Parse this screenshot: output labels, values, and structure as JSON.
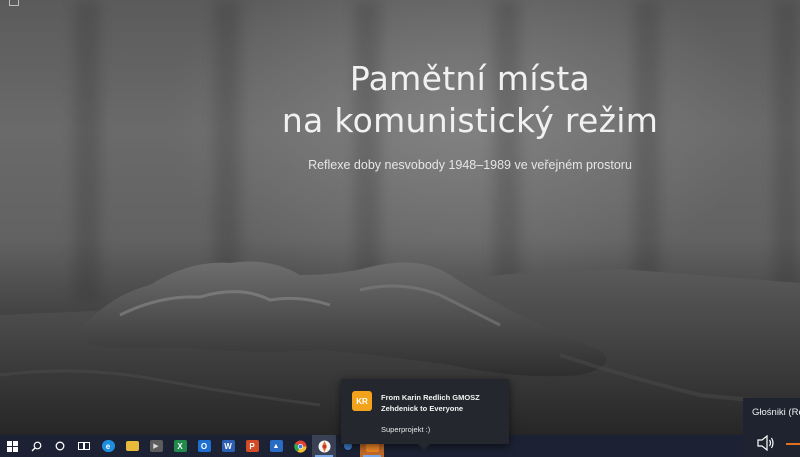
{
  "hero": {
    "title_line1": "Pamětní místa",
    "title_line2": "na komunistický režim",
    "subtitle": "Reflexe doby nesvobody 1948–1989 ve veřejném prostoru"
  },
  "taskbar": {
    "start_icon": "windows-start-icon",
    "search_icon": "search-icon",
    "cortana_icon": "cortana-circle-icon",
    "taskview_icon": "task-view-icon",
    "apps": [
      {
        "name": "edge",
        "icon": "edge-icon",
        "color": "#1e8fe0",
        "glyph": "e"
      },
      {
        "name": "file-explorer",
        "icon": "folder-icon",
        "color": "#e8b93a",
        "glyph": ""
      },
      {
        "name": "media-player",
        "icon": "media-player-icon",
        "color": "#d9d9d9",
        "glyph": "▶"
      },
      {
        "name": "excel",
        "icon": "excel-icon",
        "color": "#1f8a4c",
        "glyph": "X"
      },
      {
        "name": "outlook",
        "icon": "outlook-icon",
        "color": "#1d6fd1",
        "glyph": "O"
      },
      {
        "name": "word",
        "icon": "word-icon",
        "color": "#2b5fb3",
        "glyph": "W"
      },
      {
        "name": "powerpoint",
        "icon": "powerpoint-icon",
        "color": "#d24b26",
        "glyph": "P"
      },
      {
        "name": "photos",
        "icon": "photos-icon",
        "color": "#2a6cc4",
        "glyph": "▲"
      },
      {
        "name": "chrome",
        "icon": "chrome-icon",
        "color": "#e34133",
        "glyph": "●"
      },
      {
        "name": "firefox-like",
        "icon": "colorful-app-icon",
        "color": "#e36b2c",
        "glyph": "◆"
      },
      {
        "name": "teams",
        "icon": "app-icon",
        "color": "#3d7cc9",
        "glyph": ""
      },
      {
        "name": "zoom",
        "icon": "zoom-icon",
        "color": "#f08a24",
        "glyph": ""
      }
    ]
  },
  "notification": {
    "avatar_initials": "KR",
    "title": "From Karin Redlich GMOSZ Zehdenick to Everyone",
    "message": "Superprojekt :)",
    "accent": "#f2a31b"
  },
  "audio": {
    "label": "Głośniki (Re",
    "icon": "speaker-icon"
  }
}
